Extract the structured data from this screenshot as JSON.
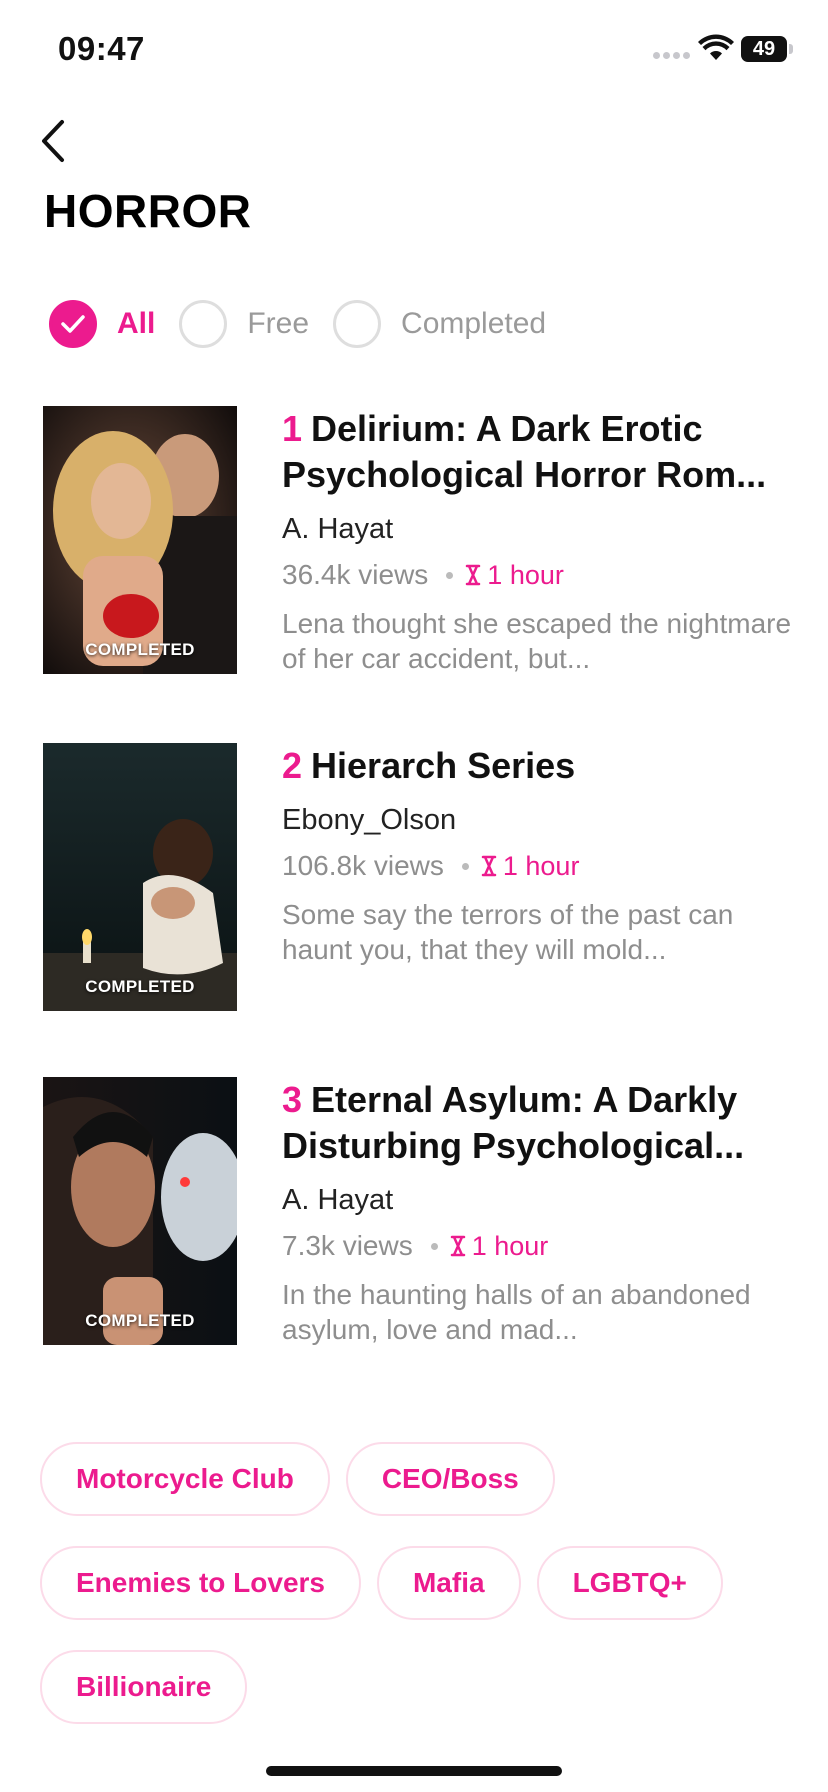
{
  "status_bar": {
    "time": "09:47",
    "battery": "49"
  },
  "header": {
    "title": "HORROR"
  },
  "filters": [
    {
      "label": "All",
      "checked": true
    },
    {
      "label": "Free",
      "checked": false
    },
    {
      "label": "Completed",
      "checked": false
    }
  ],
  "books": [
    {
      "rank": "1",
      "title": "Delirium: A Dark Erotic Psychological Horror Rom...",
      "author": "A. Hayat",
      "views": "36.4k views",
      "duration": "1 hour",
      "description": "Lena thought she escaped the nightmare of her car accident, but...",
      "badge": "COMPLETED"
    },
    {
      "rank": "2",
      "title": "Hierarch Series",
      "author": "Ebony_Olson",
      "views": "106.8k views",
      "duration": "1 hour",
      "description": "Some say the terrors of the past can haunt you, that they will mold...",
      "badge": "COMPLETED"
    },
    {
      "rank": "3",
      "title": "Eternal Asylum: A Darkly Disturbing Psychological...",
      "author": "A. Hayat",
      "views": "7.3k views",
      "duration": "1 hour",
      "description": "In the haunting halls of an abandoned asylum, love and mad...",
      "badge": "COMPLETED"
    }
  ],
  "tags": [
    "Motorcycle Club",
    "CEO/Boss",
    "Enemies to Lovers",
    "Mafia",
    "LGBTQ+",
    "Billionaire"
  ],
  "colors": {
    "accent": "#ec1b8e",
    "tag_border": "#fcdbe9",
    "muted_text": "#8e8e8e"
  }
}
